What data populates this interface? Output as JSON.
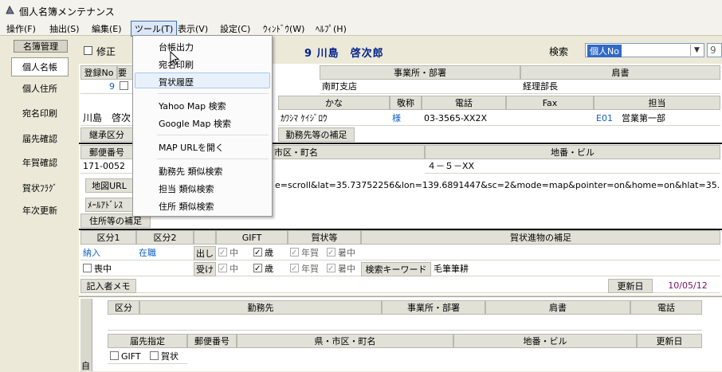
{
  "window": {
    "title": "個人名簿メンテナンス"
  },
  "menubar": [
    "操作(F)",
    "抽出(S)",
    "編集(E)",
    "ツール(T)",
    "表示(V)",
    "設定(C)",
    "ｳｨﾝﾄﾞｳ(W)",
    "ﾍﾙﾌﾟ(H)"
  ],
  "sidebar": {
    "header": "名簿管理",
    "items": [
      "個人名帳",
      "個人住所",
      "宛名印刷",
      "届先確認",
      "年賀確認",
      "賀状ﾌﾗｸﾞ",
      "年次更新"
    ]
  },
  "toolbar": {
    "mode": "修正",
    "person": "9 川島　啓次郎",
    "search_label": "検索",
    "search_value": "個人No",
    "search_input": "9"
  },
  "form": {
    "reg_no_label": "登録No",
    "reg_no_trunc": "要",
    "reg_no": "9",
    "office_label": "事業所・部署",
    "office": "南町支店",
    "title_label": "肩書",
    "title": "経理部長",
    "name": "川島　啓次",
    "kana_label": "かな",
    "kana": "ｶﾜｼﾏ ｹｲｼﾞﾛｳ",
    "honorific_label": "敬称",
    "honorific": "様",
    "phone_label": "電話",
    "phone": "03-3565-XX2X",
    "fax_label": "Fax",
    "staff_label": "担当",
    "staff_code": "E01",
    "staff": "営業第一部",
    "inherit_label": "継承区分",
    "work_supp": "勤務先等の補足",
    "postal_label": "郵便番号",
    "pref_label_trunc": "市区・町名",
    "postal": "171-0052",
    "street_label": "地番・ビル",
    "street": "４－５－XX",
    "map_label": "地図URL",
    "map_url": "e=scroll&lat=35.73752256&lon=139.6891447&sc=2&mode=map&pointer=on&home=on&hlat=35.738",
    "mail_label": "ﾒｰﾙｱﾄﾞﾚｽ",
    "addr_supp": "住所等の補足",
    "kubun1_label": "区分1",
    "kubun2_label": "区分2",
    "gift_label": "GIFT",
    "card_label": "賀状等",
    "card_supp_label": "賀状進物の補足",
    "kubun1": "納入",
    "kubun2": "在職",
    "out_label": "出し",
    "in_label": "受け",
    "chu": "中",
    "sai": "歳",
    "nenga": "年賀",
    "shochu": "暑中",
    "mochu": "喪中",
    "keyword_label": "検索キーワード",
    "keyword": "毛筆筆耕",
    "memo_label": "記入者メモ",
    "updated_label": "更新日",
    "updated": "10/05/12"
  },
  "subgrid": {
    "row1": [
      "区分",
      "勤務先",
      "事業所・部署",
      "肩書",
      "電話"
    ],
    "row2": [
      "届先指定",
      "郵便番号",
      "県・市区・町名",
      "地番・ビル",
      "更新日"
    ],
    "gift": "GIFT",
    "card": "賀状",
    "side": "自"
  },
  "tools_menu": {
    "items": [
      "台帳出力",
      "宛名印刷",
      "賀状履歴",
      "Yahoo Map 検索",
      "Google Map 検索",
      "MAP URLを開く",
      "勤務先 類似検索",
      "担当 類似検索",
      "住所 類似検索"
    ]
  }
}
